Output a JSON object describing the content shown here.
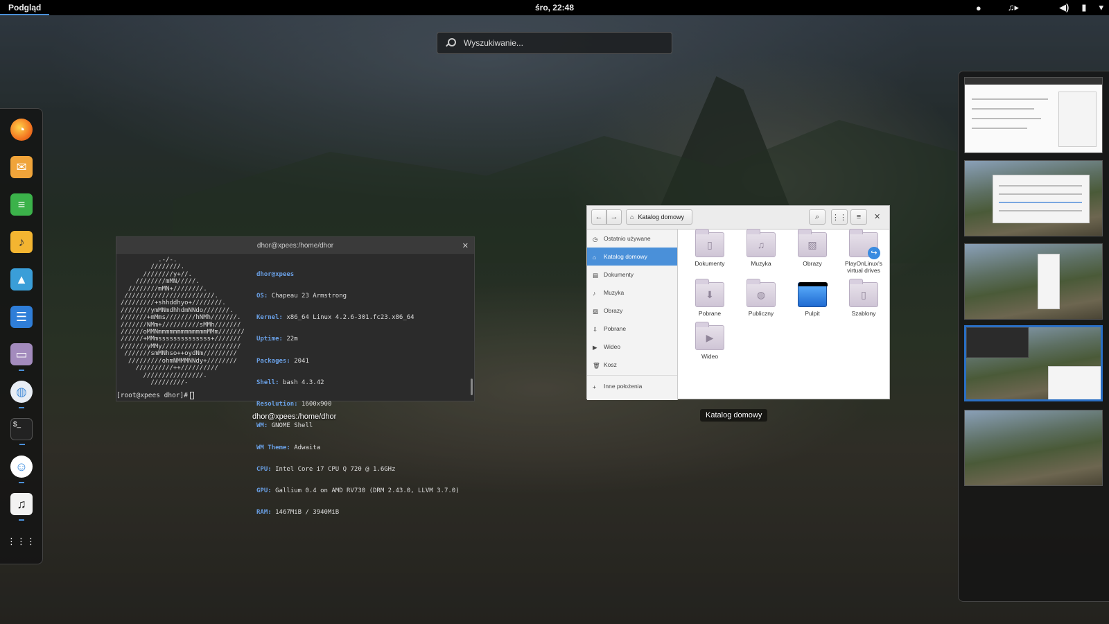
{
  "topbar": {
    "activities_label": "Podgląd",
    "clock": "śro, 22:48",
    "tray": {
      "chat_icon": "chat-bubble-icon",
      "music_icon": "music-note-icon",
      "volume_icon": "speaker-icon",
      "battery_icon": "battery-icon",
      "menu_icon": "chevron-down-icon"
    }
  },
  "search": {
    "placeholder": "Wyszukiwanie..."
  },
  "dash": {
    "apps": [
      {
        "name": "firefox",
        "icon": "firefox-icon",
        "color": "#f37621",
        "running": false
      },
      {
        "name": "mail",
        "icon": "mail-icon",
        "color": "#f0a43a",
        "running": false
      },
      {
        "name": "notes",
        "icon": "document-green-icon",
        "color": "#3bb24a",
        "running": false
      },
      {
        "name": "music-player",
        "icon": "music-note-icon",
        "color": "#f3b531",
        "running": false
      },
      {
        "name": "photos",
        "icon": "photos-icon",
        "color": "#3a9ed8",
        "running": false
      },
      {
        "name": "text-editor",
        "icon": "text-editor-icon",
        "color": "#2f7ed8",
        "running": false
      },
      {
        "name": "files",
        "icon": "files-icon",
        "color": "#a38bbd",
        "running": true
      },
      {
        "name": "web",
        "icon": "globe-icon",
        "color": "#4a90d9",
        "running": true
      },
      {
        "name": "terminal",
        "icon": "terminal-icon",
        "color": "#222222",
        "running": true
      },
      {
        "name": "chat",
        "icon": "chat-smiley-icon",
        "color": "#3f8fe0",
        "running": true
      },
      {
        "name": "rhythmbox",
        "icon": "music-note-white-icon",
        "color": "#f2f2f2",
        "running": true
      }
    ],
    "show_apps_icon": "app-grid-icon"
  },
  "terminal": {
    "title": "dhor@xpees:/home/dhor",
    "label": "dhor@xpees:/home/dhor",
    "ascii_art": "          .-/-.\n        ////////.\n      ////////y+//.\n    ////////mMN/////.\n  ////////mMN+////////.\n ////////////////////////.\n/////////+shhddhyo+////////.\n////////ymMNmdhhdmNNdo///////.\n///////+mMms////////hNMh///////.\n///////NMm+//////////sMMh///////\n//////oMMNmmmmmmmmmmmmmMMm///////\n//////+MMmssssssssssssss+///////\n///////yMMy/////////////////////\n ///////smMNhso++oydNm/////////\n  /////////ohmNMMMNNdy+////////\n    //////////++//////////\n      ////////////////.\n        /////////-",
    "user_host": "dhor@xpees",
    "info": [
      {
        "key": "OS:",
        "value": "Chapeau 23 Armstrong"
      },
      {
        "key": "Kernel:",
        "value": "x86_64 Linux 4.2.6-301.fc23.x86_64"
      },
      {
        "key": "Uptime:",
        "value": "22m"
      },
      {
        "key": "Packages:",
        "value": "2041"
      },
      {
        "key": "Shell:",
        "value": "bash 4.3.42"
      },
      {
        "key": "Resolution:",
        "value": "1600x900"
      },
      {
        "key": "WM:",
        "value": "GNOME Shell"
      },
      {
        "key": "WM Theme:",
        "value": "Adwaita"
      },
      {
        "key": "CPU:",
        "value": "Intel Core i7 CPU Q 720 @ 1.6GHz"
      },
      {
        "key": "GPU:",
        "value": "Gallium 0.4 on AMD RV730 (DRM 2.43.0, LLVM 3.7.0)"
      },
      {
        "key": "RAM:",
        "value": "1467MiB / 3940MiB"
      }
    ],
    "prompt": "[root@xpees dhor]#"
  },
  "files": {
    "label": "Katalog domowy",
    "location": "Katalog domowy",
    "sidebar": [
      {
        "label": "Ostatnio używane",
        "icon": "clock-icon",
        "active": false
      },
      {
        "label": "Katalog domowy",
        "icon": "home-icon",
        "active": true
      },
      {
        "label": "Dokumenty",
        "icon": "document-icon",
        "active": false
      },
      {
        "label": "Muzyka",
        "icon": "music-icon",
        "active": false
      },
      {
        "label": "Obrazy",
        "icon": "image-icon",
        "active": false
      },
      {
        "label": "Pobrane",
        "icon": "download-icon",
        "active": false
      },
      {
        "label": "Wideo",
        "icon": "video-icon",
        "active": false
      },
      {
        "label": "Kosz",
        "icon": "trash-icon",
        "active": false
      }
    ],
    "other_locations": "Inne położenia",
    "items": [
      {
        "label": "Dokumenty",
        "icon": "folder-documents-icon"
      },
      {
        "label": "Muzyka",
        "icon": "folder-music-icon"
      },
      {
        "label": "Obrazy",
        "icon": "folder-pictures-icon"
      },
      {
        "label": "PlayOnLinux's virtual drives",
        "icon": "folder-link-icon"
      },
      {
        "label": "Pobrane",
        "icon": "folder-download-icon"
      },
      {
        "label": "Publiczny",
        "icon": "folder-public-icon"
      },
      {
        "label": "Pulpit",
        "icon": "folder-desktop-icon"
      },
      {
        "label": "Szablony",
        "icon": "folder-templates-icon"
      },
      {
        "label": "Wideo",
        "icon": "folder-video-icon"
      }
    ]
  },
  "workspaces": {
    "count": 5,
    "active_index": 3
  }
}
